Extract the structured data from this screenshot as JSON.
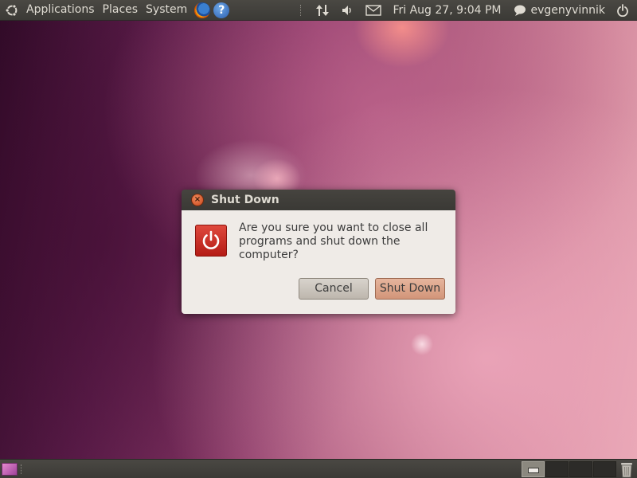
{
  "top_panel": {
    "menus": {
      "applications": "Applications",
      "places": "Places",
      "system": "System"
    },
    "launchers": [
      {
        "name": "firefox",
        "icon": "firefox-icon"
      },
      {
        "name": "help",
        "icon": "help-icon",
        "glyph": "?"
      }
    ],
    "clock": "Fri Aug 27,  9:04 PM",
    "username": "evgenyvinnik",
    "tray_icons": [
      "network-icon",
      "volume-icon",
      "mail-icon",
      "chat-status-icon",
      "power-icon"
    ]
  },
  "dialog": {
    "title": "Shut Down",
    "close_glyph": "×",
    "message": "Are you sure you want to close all programs and shut down the computer?",
    "buttons": {
      "cancel": "Cancel",
      "shutdown": "Shut Down"
    }
  },
  "bottom_panel": {
    "workspaces": 4,
    "active_workspace": 1
  },
  "colors": {
    "panel": "#3b3a36",
    "dialog_bg": "#efebe7",
    "power_red": "#c62a20",
    "accent_orange": "#d29579"
  }
}
